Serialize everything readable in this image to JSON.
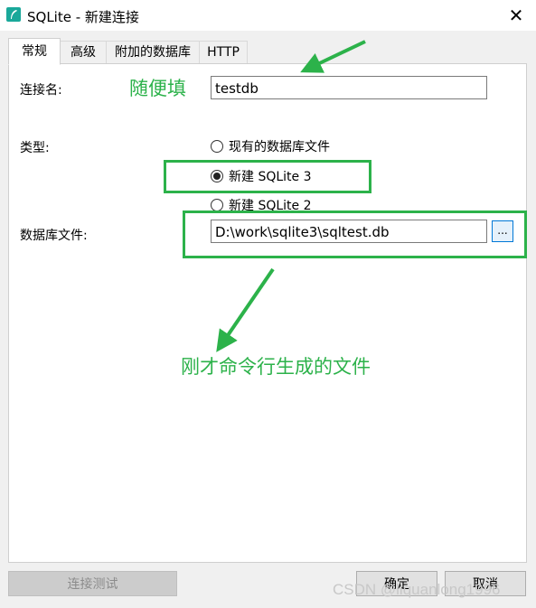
{
  "window": {
    "title": "SQLite - 新建连接",
    "close_glyph": "✕"
  },
  "tabs": [
    {
      "label": "常规",
      "active": true
    },
    {
      "label": "高级",
      "active": false
    },
    {
      "label": "附加的数据库",
      "active": false
    },
    {
      "label": "HTTP",
      "active": false
    }
  ],
  "form": {
    "connection_name_label": "连接名:",
    "connection_name_value": "testdb",
    "type_label": "类型:",
    "type_options": [
      {
        "label": "现有的数据库文件",
        "checked": false
      },
      {
        "label": "新建 SQLite 3",
        "checked": true
      },
      {
        "label": "新建 SQLite 2",
        "checked": false
      }
    ],
    "db_file_label": "数据库文件:",
    "db_file_value": "D:\\work\\sqlite3\\sqltest.db",
    "browse_label": "..."
  },
  "annotations": {
    "fill_any": "随便填",
    "generated_file": "刚才命令行生成的文件",
    "color": "#2cb24a"
  },
  "buttons": {
    "test_connection": "连接测试",
    "ok": "确定",
    "cancel": "取消"
  },
  "watermark": "CSDN @liquanlong1996"
}
